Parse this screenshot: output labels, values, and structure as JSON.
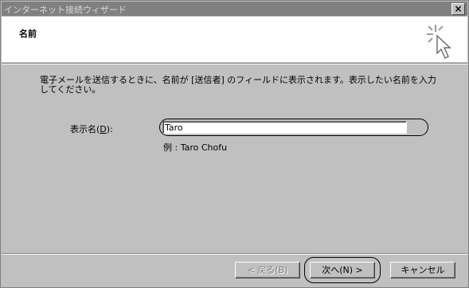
{
  "window": {
    "title": "インターネット接続ウィザード",
    "close_glyph": "×"
  },
  "header": {
    "heading": "名前",
    "icon": "wizard-cursor-icon"
  },
  "body": {
    "description": "電子メールを送信するときに、名前が [送信者] のフィールドに表示されます。表示したい名前を入力してください。",
    "name_label_prefix": "表示名(",
    "name_label_key": "D",
    "name_label_suffix": "):",
    "name_value": "Taro",
    "example": "例 : Taro Chofu"
  },
  "buttons": {
    "back": "< 戻る(B)",
    "next": "次へ(N) >",
    "cancel": "キャンセル"
  }
}
